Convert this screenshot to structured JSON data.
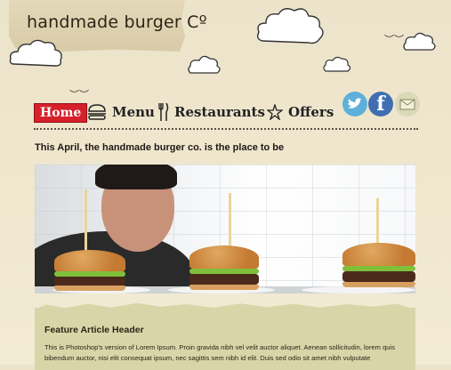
{
  "header": {
    "brand": "handmade burger Cº"
  },
  "nav": {
    "items": [
      {
        "label": "Home",
        "icon": "home"
      },
      {
        "label": "Menu",
        "icon": "burger-icon"
      },
      {
        "label": "Restaurants",
        "icon": "cutlery-icon"
      },
      {
        "label": "Offers",
        "icon": "star-icon"
      }
    ]
  },
  "social": {
    "twitter": "twitter-icon",
    "facebook_glyph": "f",
    "email": "email-icon"
  },
  "tagline": "This April, the handmade burger co. is the place to be",
  "feature": {
    "title": "Feature Article Header",
    "body": "This is Photoshop's version  of Lorem Ipsum. Proin gravida nibh vel velit auctor aliquet. Aenean sollicitudin, lorem quis bibendum auctor, nisi elit consequat ipsum, nec sagittis sem nibh id elit. Duis sed odio sit amet nibh vulputate"
  },
  "colors": {
    "accent": "#d6202a",
    "twitter": "#5fb0d8",
    "facebook": "#3f6fb1",
    "feature_bg": "#d8d6a8"
  }
}
